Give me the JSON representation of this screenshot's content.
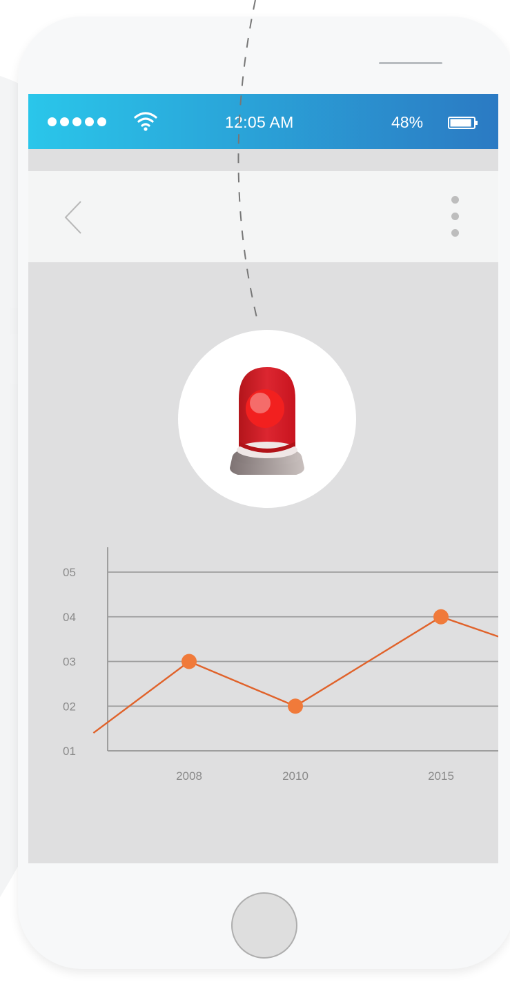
{
  "status_bar": {
    "signal_dots": 5,
    "time": "12:05 AM",
    "battery_percent": "48%",
    "battery_level": 0.48
  },
  "icons": {
    "back": "chevron-left-icon",
    "more": "vertical-dots-icon",
    "siren": "alarm-siren-icon",
    "wifi": "wifi-icon",
    "battery": "battery-icon"
  },
  "colors": {
    "status_gradient_start": "#2ac6ea",
    "status_gradient_end": "#2b7ac3",
    "line": "#e0622a",
    "point": "#f07a3a",
    "grid": "#9e9e9e",
    "siren_red": "#d42027"
  },
  "chart_data": {
    "type": "line",
    "categories": [
      "2008",
      "2010",
      "2015"
    ],
    "y_tick_labels": [
      "01",
      "02",
      "03",
      "04",
      "05"
    ],
    "ylim": [
      1,
      5
    ],
    "grid": true,
    "series": [
      {
        "x": [
          2006.2,
          2008,
          2010,
          2015,
          2017
        ],
        "y": [
          1.4,
          3,
          2,
          4,
          3.55
        ],
        "marker_indices": [
          1,
          2,
          3
        ]
      }
    ]
  }
}
